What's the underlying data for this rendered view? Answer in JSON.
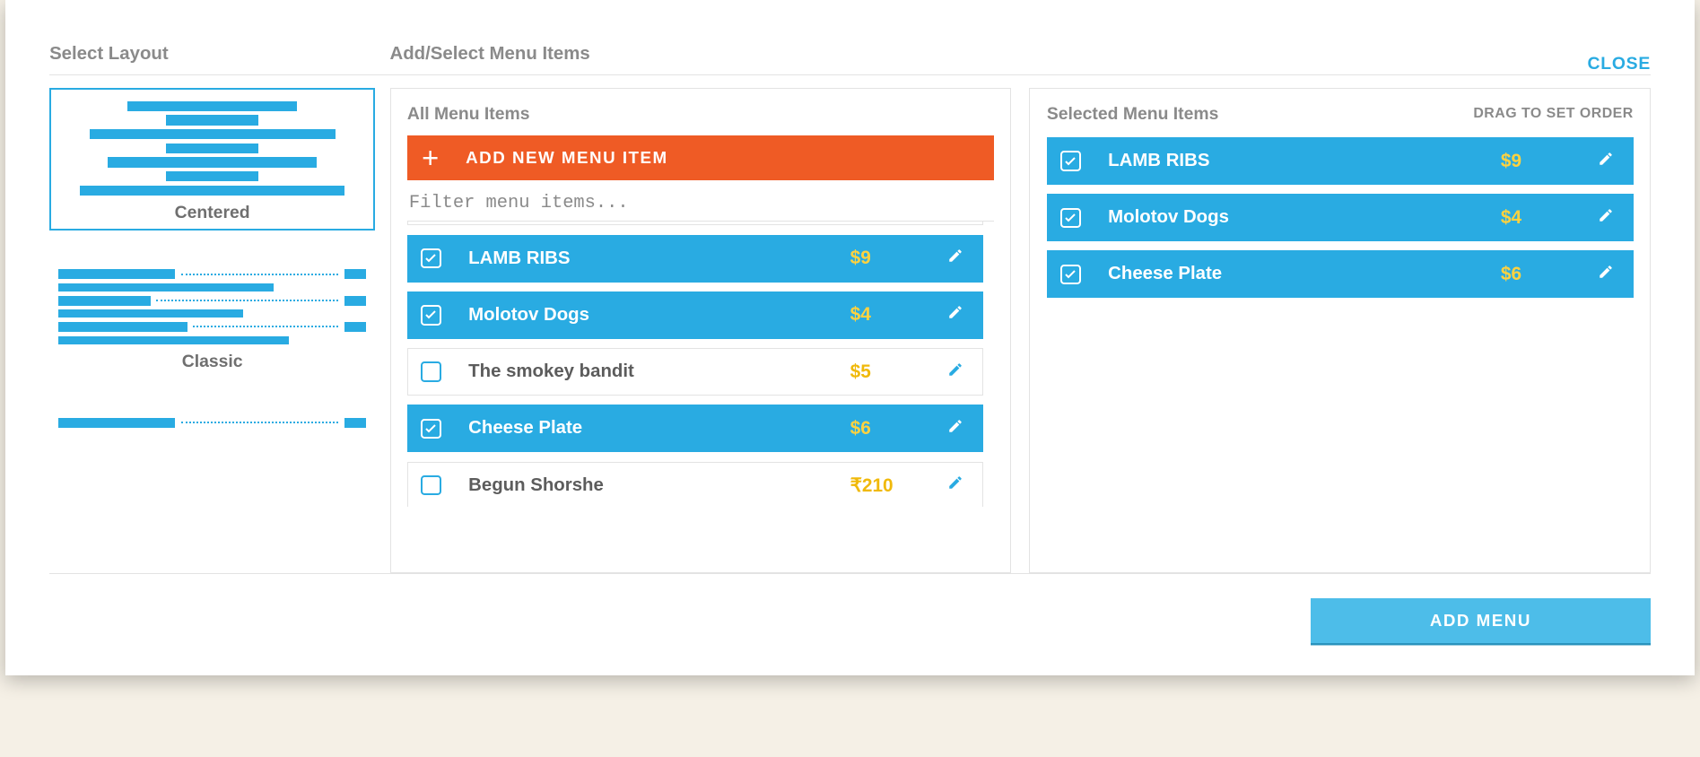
{
  "titles": {
    "layout": "Select Layout",
    "items": "Add/Select Menu Items",
    "close": "CLOSE"
  },
  "layouts": [
    {
      "name": "Centered",
      "selected": true
    },
    {
      "name": "Classic",
      "selected": false
    }
  ],
  "all_panel": {
    "title": "All Menu Items",
    "add_new": "ADD NEW MENU ITEM",
    "filter_placeholder": "Filter menu items...",
    "items": [
      {
        "name": "LAMB RIBS",
        "price": "$9",
        "selected": true
      },
      {
        "name": "Molotov Dogs",
        "price": "$4",
        "selected": true
      },
      {
        "name": "The smokey bandit",
        "price": "$5",
        "selected": false
      },
      {
        "name": "Cheese Plate",
        "price": "$6",
        "selected": true
      },
      {
        "name": "Begun Shorshe",
        "price": "₹210",
        "selected": false
      }
    ]
  },
  "sel_panel": {
    "title": "Selected Menu Items",
    "drag_hint": "DRAG TO SET ORDER",
    "items": [
      {
        "name": "LAMB RIBS",
        "price": "$9"
      },
      {
        "name": "Molotov Dogs",
        "price": "$4"
      },
      {
        "name": "Cheese Plate",
        "price": "$6"
      }
    ]
  },
  "footer": {
    "add_menu": "ADD MENU"
  }
}
